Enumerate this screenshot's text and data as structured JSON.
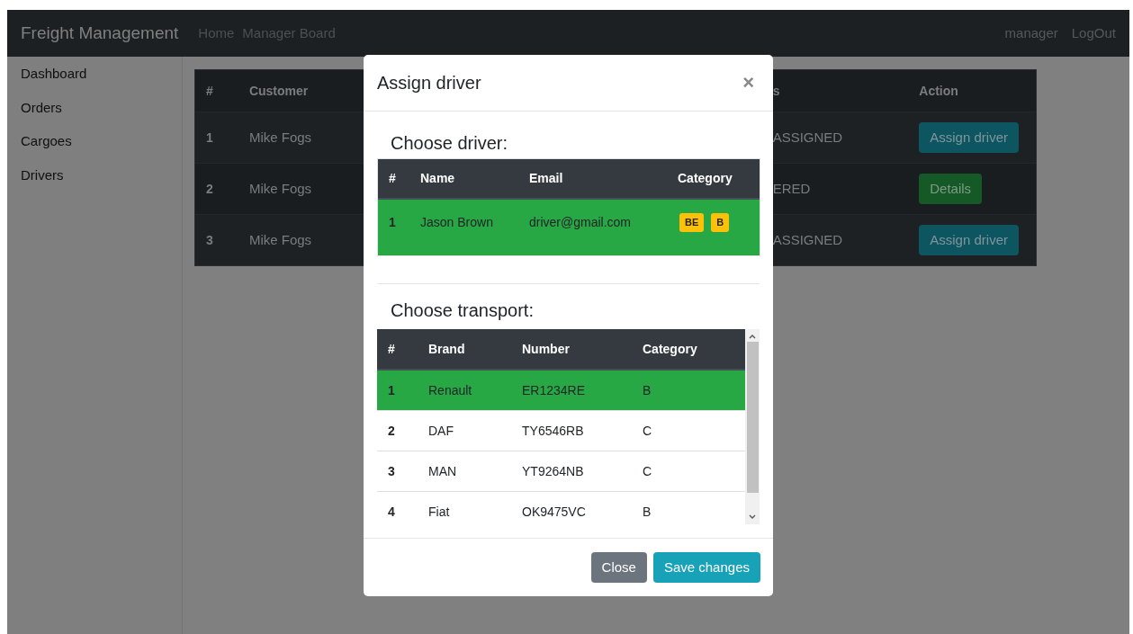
{
  "navbar": {
    "brand": "Freight Management",
    "links": [
      {
        "label": "Home"
      },
      {
        "label": "Manager Board"
      }
    ],
    "user": "manager",
    "logout": "LogOut"
  },
  "sidebar": {
    "items": [
      {
        "label": "Dashboard"
      },
      {
        "label": "Orders"
      },
      {
        "label": "Cargoes"
      },
      {
        "label": "Drivers"
      }
    ]
  },
  "orders_table": {
    "columns": [
      "#",
      "Customer",
      "s",
      "Action"
    ],
    "rows": [
      {
        "number": "1",
        "customer": "Mike Fogs",
        "status": "ASSIGNED",
        "action": {
          "label": "Assign driver",
          "kind": "assign"
        }
      },
      {
        "number": "2",
        "customer": "Mike Fogs",
        "status": "ERED",
        "action": {
          "label": "Details",
          "kind": "details"
        }
      },
      {
        "number": "3",
        "customer": "Mike Fogs",
        "status": "ASSIGNED",
        "action": {
          "label": "Assign driver",
          "kind": "assign"
        }
      }
    ]
  },
  "modal": {
    "title": "Assign driver",
    "close": "×",
    "driver_section": {
      "heading": "Choose driver:",
      "columns": [
        "#",
        "Name",
        "Email",
        "Category"
      ],
      "rows": [
        {
          "number": "1",
          "name": "Jason Brown",
          "email": "driver@gmail.com",
          "categories": [
            "BE",
            "B"
          ],
          "selected": true
        }
      ]
    },
    "transport_section": {
      "heading": "Choose transport:",
      "columns": [
        "#",
        "Brand",
        "Number",
        "Category"
      ],
      "rows": [
        {
          "number": "1",
          "brand": "Renault",
          "plate": "ER1234RE",
          "category": "B",
          "selected": true
        },
        {
          "number": "2",
          "brand": "DAF",
          "plate": "TY6546RB",
          "category": "C",
          "selected": false
        },
        {
          "number": "3",
          "brand": "MAN",
          "plate": "YT9264NB",
          "category": "C",
          "selected": false
        },
        {
          "number": "4",
          "brand": "Fiat",
          "plate": "OK9475VC",
          "category": "B",
          "selected": false
        }
      ]
    },
    "buttons": [
      {
        "label": "Close",
        "kind": "secondary"
      },
      {
        "label": "Save changes",
        "kind": "primary"
      }
    ]
  }
}
